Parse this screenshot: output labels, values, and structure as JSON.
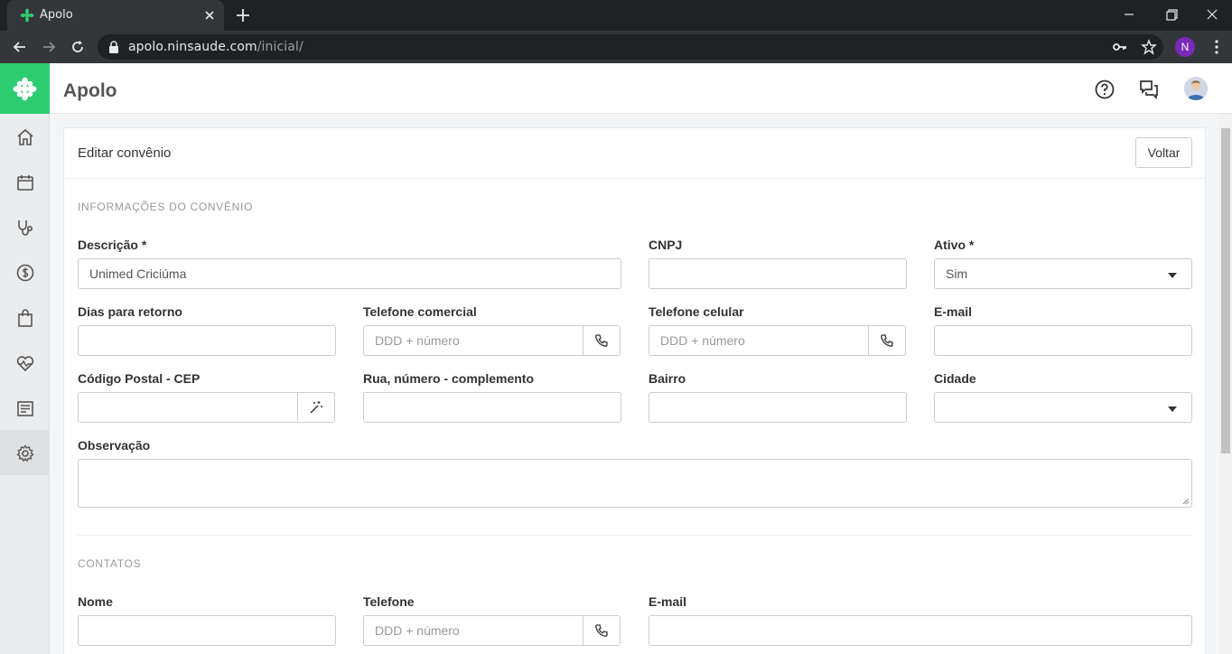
{
  "browser": {
    "tab_title": "Apolo",
    "url_host": "apolo.ninsaude.com",
    "url_path": "/inicial/",
    "profile_initial": "N"
  },
  "app": {
    "title": "Apolo",
    "brand_color": "#2ecc71"
  },
  "sidebar": {
    "items": [
      {
        "icon": "home-icon"
      },
      {
        "icon": "calendar-icon"
      },
      {
        "icon": "stethoscope-icon"
      },
      {
        "icon": "dollar-icon"
      },
      {
        "icon": "shopping-bag-icon"
      },
      {
        "icon": "heart-pulse-icon"
      },
      {
        "icon": "report-icon"
      },
      {
        "icon": "gear-icon",
        "active": true
      }
    ]
  },
  "page": {
    "title": "Editar convênio",
    "back_label": "Voltar"
  },
  "section_info": {
    "label": "INFORMAÇÕES DO CONVÊNIO",
    "descricao_label": "Descrição *",
    "descricao_value": "Unimed Criciúma",
    "cnpj_label": "CNPJ",
    "ativo_label": "Ativo *",
    "ativo_value": "Sim",
    "dias_label": "Dias para retorno",
    "tel_comercial_label": "Telefone comercial",
    "tel_placeholder": "DDD + número",
    "tel_celular_label": "Telefone celular",
    "email_label": "E-mail",
    "cep_label": "Código Postal - CEP",
    "rua_label": "Rua, número - complemento",
    "bairro_label": "Bairro",
    "cidade_label": "Cidade",
    "obs_label": "Observação"
  },
  "section_contacts": {
    "label": "CONTATOS",
    "nome_label": "Nome",
    "telefone_label": "Telefone",
    "telefone_placeholder": "DDD + número",
    "email_label": "E-mail"
  }
}
